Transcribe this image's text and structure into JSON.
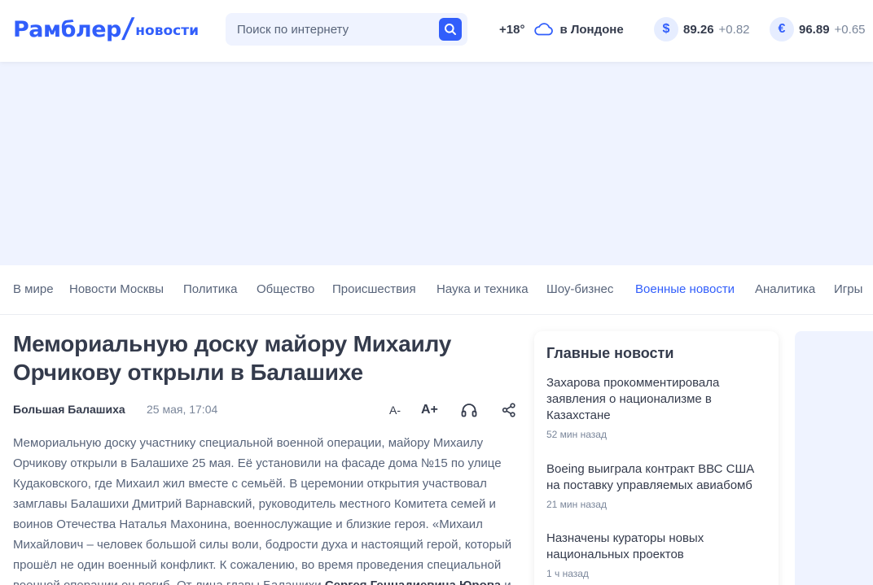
{
  "header": {
    "logo": {
      "main": "Рамблер",
      "slash": "/",
      "sub": "новости"
    },
    "search": {
      "placeholder": "Поиск по интернету"
    },
    "weather": {
      "temp": "+18°",
      "icon": "cloud-icon",
      "location": "в Лондоне"
    },
    "rates": [
      {
        "symbol": "$",
        "value": "89.26",
        "change": "+0.82"
      },
      {
        "symbol": "€",
        "value": "96.89",
        "change": "+0.65"
      }
    ]
  },
  "nav": {
    "items": [
      {
        "label": "В мире"
      },
      {
        "label": "Новости Москвы"
      },
      {
        "label": "Политика"
      },
      {
        "label": "Общество"
      },
      {
        "label": "Происшествия"
      },
      {
        "label": "Наука и техника"
      },
      {
        "label": "Шоу-бизнес"
      },
      {
        "label": "Военные новости",
        "active": true
      },
      {
        "label": "Аналитика"
      },
      {
        "label": "Игры"
      }
    ]
  },
  "article": {
    "title": "Мемориальную доску майору Михаилу Орчикову открыли в Балашихе",
    "source": "Большая Балашиха",
    "date": "25 мая, 17:04",
    "tools": {
      "font_smaller": "A-",
      "font_larger": "A+"
    },
    "body_part1": "Мемориальную доску участнику специальной военной операции, майору Михаилу Орчикову открыли в Балашихе 25 мая. Её установили на фасаде дома №15 по улице Кудаковского, где Михаил жил вместе с семьёй. В церемонии открытия участвовал замглавы Балашихи Дмитрий Варнавский, руководитель местного Комитета семей и воинов Отечества Наталья Махонина, военнослужащие и близкие героя. «Михаил Михайлович – человек большой силы воли, бодрости духа и настоящий герой, который прошёл не один военный конфликт. К сожалению, во время проведения специальной военной операции он погиб. От лица главы Балашихи ",
    "body_bold": "Сергея Геннадиевича Юрова",
    "body_part2": " и"
  },
  "sidebar": {
    "title": "Главные новости",
    "news": [
      {
        "title": "Захарова прокомментировала заявления о национализме в Казахстане",
        "time": "52 мин назад"
      },
      {
        "title": "Boeing выиграла контракт ВВС США на поставку управляемых авиабомб",
        "time": "21 мин назад"
      },
      {
        "title": "Назначены кураторы новых национальных проектов",
        "time": "1 ч назад"
      }
    ]
  },
  "colors": {
    "accent": "#315efb",
    "text": "#343b4c",
    "muted": "#7a869a",
    "banner": "#eff3ff"
  }
}
